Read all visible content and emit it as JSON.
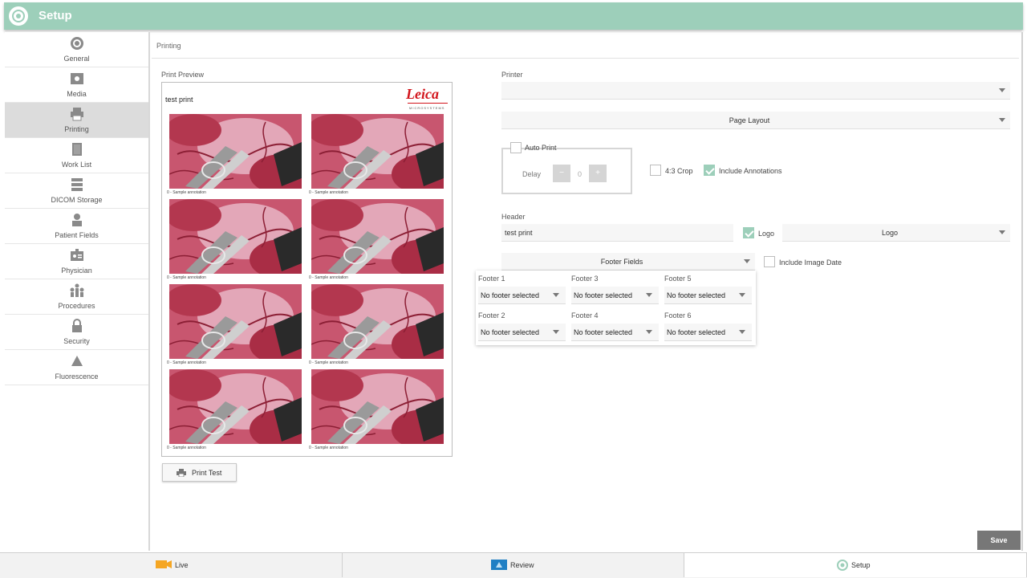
{
  "app": {
    "title": "Setup"
  },
  "sidebar": {
    "items": [
      {
        "label": "General",
        "icon": "gear-icon",
        "active": false
      },
      {
        "label": "Media",
        "icon": "media-icon",
        "active": false
      },
      {
        "label": "Printing",
        "icon": "printer-icon",
        "active": true
      },
      {
        "label": "Work List",
        "icon": "worklist-icon",
        "active": false
      },
      {
        "label": "DICOM Storage",
        "icon": "storage-icon",
        "active": false
      },
      {
        "label": "Patient Fields",
        "icon": "patient-icon",
        "active": false
      },
      {
        "label": "Physician",
        "icon": "physician-icon",
        "active": false
      },
      {
        "label": "Procedures",
        "icon": "procedures-icon",
        "active": false
      },
      {
        "label": "Security",
        "icon": "lock-icon",
        "active": false
      },
      {
        "label": "Fluorescence",
        "icon": "triangle-icon",
        "active": false
      }
    ]
  },
  "page": {
    "breadcrumb": "Printing"
  },
  "preview": {
    "label": "Print Preview",
    "header_text": "test print",
    "brand": "Leica",
    "brand_sub": "MICROSYSTEMS",
    "captions": [
      "0 - Sample annotation",
      "0 - Sample annotation",
      "0 - Sample annotation",
      "0 - Sample annotation",
      "0 - Sample annotation",
      "0 - Sample annotation",
      "0 - Sample annotation",
      "0 - Sample annotation"
    ]
  },
  "print_test_label": "Print Test",
  "printer": {
    "label": "Printer",
    "value": ""
  },
  "page_layout": {
    "value": "Page Layout"
  },
  "auto_print": {
    "label": "Auto Print",
    "checked": false,
    "delay_label": "Delay",
    "delay_value": "0",
    "minus": "−",
    "plus": "+"
  },
  "crop": {
    "label": "4:3 Crop",
    "checked": false
  },
  "annotations": {
    "label": "Include Annotations",
    "checked": true
  },
  "header": {
    "label": "Header",
    "value": "test print"
  },
  "logo": {
    "label": "Logo",
    "checked": true,
    "select_value": "Logo"
  },
  "footer_fields": {
    "value": "Footer Fields"
  },
  "image_date": {
    "label": "Include Image Date",
    "checked": false
  },
  "footers": [
    {
      "label": "Footer 1",
      "value": "No footer selected"
    },
    {
      "label": "Footer 3",
      "value": "No footer selected"
    },
    {
      "label": "Footer 5",
      "value": "No footer selected"
    },
    {
      "label": "Footer 2",
      "value": "No footer selected"
    },
    {
      "label": "Footer 4",
      "value": "No footer selected"
    },
    {
      "label": "Footer 6",
      "value": "No footer selected"
    }
  ],
  "save_label": "Save",
  "bottom_tabs": [
    {
      "label": "Live",
      "icon": "camera-icon"
    },
    {
      "label": "Review",
      "icon": "review-icon"
    },
    {
      "label": "Setup",
      "icon": "setup-icon",
      "active": true
    }
  ],
  "colors": {
    "accent": "#9dcfba",
    "brand_red": "#d2141b",
    "save_bg": "#777777"
  }
}
